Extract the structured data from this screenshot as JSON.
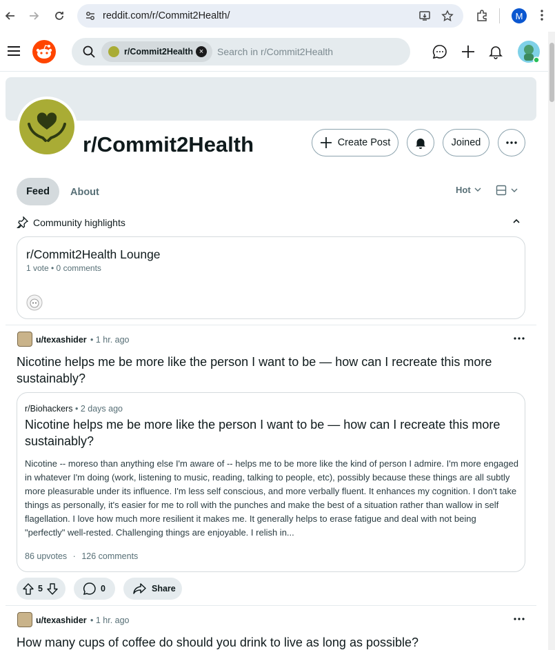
{
  "browser": {
    "url": "reddit.com/r/Commit2Health/",
    "profile_initial": "M"
  },
  "header": {
    "search_chip": "r/Commit2Health",
    "search_placeholder": "Search in r/Commit2Health"
  },
  "subreddit": {
    "name": "r/Commit2Health",
    "create_post": "Create Post",
    "joined": "Joined"
  },
  "tabs": {
    "feed": "Feed",
    "about": "About",
    "sort": "Hot"
  },
  "highlights": {
    "label": "Community highlights",
    "card_title": "r/Commit2Health Lounge",
    "card_meta": "1 vote • 0 comments"
  },
  "posts": [
    {
      "author": "u/texashider",
      "time": "• 1 hr. ago",
      "title": "Nicotine helps me be more like the person I want to be — how can I recreate this more sustainably?",
      "crosspost": {
        "sub": "r/Biohackers",
        "time": "• 2 days ago",
        "title": "Nicotine helps me be more like the person I want to be — how can I recreate this more sustainably?",
        "body": "Nicotine -- moreso than anything else I'm aware of -- helps me to be more like the kind of person I admire. I'm more engaged in whatever I'm doing (work, listening to music, reading, talking to people, etc), possibly because these things are all subtly more pleasurable under its influence. I'm less self conscious, and more verbally fluent. It enhances my cognition. I don't take things as personally, it's easier for me to roll with the punches and make the best of a situation rather than wallow in self flagellation. I love how much more resilient it makes me. It generally helps to erase fatigue and deal with not being \"perfectly\" well-rested. Challenging things are enjoyable. I relish in...",
        "upvotes": "86 upvotes",
        "sep": "·",
        "comments": "126 comments"
      },
      "votes": "5",
      "comments": "0",
      "share": "Share"
    },
    {
      "author": "u/texashider",
      "time": "• 1 hr. ago",
      "title": "How many cups of coffee do should you drink to live as long as possible?"
    }
  ]
}
